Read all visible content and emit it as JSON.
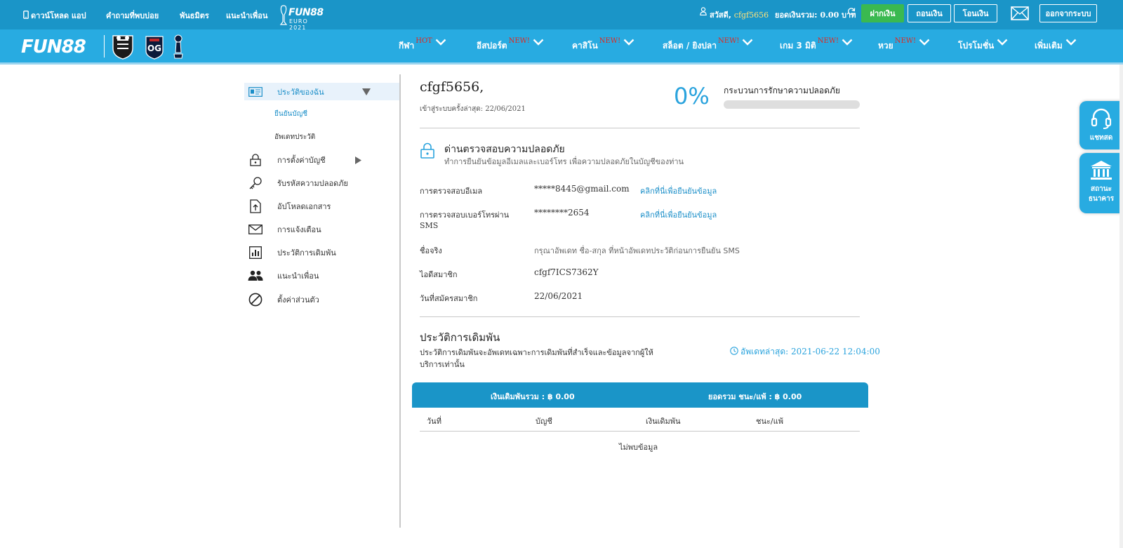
{
  "topbar": {
    "download_app": "ดาวน์โหลด แอป",
    "faq": "คำถามที่พบบ่อย",
    "affiliate": "พันธมิตร",
    "refer_friend": "แนะนำเพื่อน",
    "euro_logo_brand": "FUN88",
    "euro_logo_sub": "EURO 2021",
    "greeting": "สวัสดี,",
    "username": "cfgf5656",
    "balance_label": "ยอดเงินรวม:",
    "balance_value": "0.00 บาท",
    "deposit": "ฝากเงิน",
    "withdraw": "ถอนเงิน",
    "transfer": "โอนเงิน",
    "logout": "ออกจากระบบ"
  },
  "navbar": {
    "brand": "FUN88",
    "items": [
      {
        "label": "กีฬา",
        "badge": "HOT"
      },
      {
        "label": "อีสปอร์ต",
        "badge": "NEW!"
      },
      {
        "label": "คาสิโน",
        "badge": "NEW!"
      },
      {
        "label": "สล็อต / ยิงปลา",
        "badge": "NEW!"
      },
      {
        "label": "เกม 3 มิติ",
        "badge": "NEW!"
      },
      {
        "label": "หวย",
        "badge": "NEW!"
      },
      {
        "label": "โปรโมชั่น",
        "badge": ""
      },
      {
        "label": "เพิ่มเติม",
        "badge": ""
      }
    ]
  },
  "sidebar": {
    "my_profile": "ประวัติของฉัน",
    "verify_account": "ยืนยันบัญชี",
    "update_profile": "อัพเดทประวัติ",
    "account_settings": "การตั้งค่าบัญชี",
    "security_code": "รับรหัสความปลอดภัย",
    "upload_docs": "อัปโหลดเอกสาร",
    "notifications": "การแจ้งเตือน",
    "bet_history": "ประวัติการเดิมพัน",
    "refer_friend": "แนะนำเพื่อน",
    "personal_settings": "ตั้งค่าส่วนตัว"
  },
  "profile": {
    "username_heading": "cfgf5656,",
    "last_login": "เข้าสู่ระบบครั้งล่าสุด: 22/06/2021",
    "progress_percent_label": "0%",
    "progress_percent": 0,
    "progress_title": "กระบวนการรักษาความปลอดภัย"
  },
  "security": {
    "title": "ด่านตรวจสอบความปลอดภัย",
    "subtitle": "ทำการยืนยันข้อมูลอีเมลและเบอร์โทร เพื่อความปลอดภัยในบัญชีของท่าน",
    "rows": [
      {
        "label": "การตรวจสอบอีเมล",
        "value": "*****8445@gmail.com",
        "action": "คลิกที่นี่เพื่อยืนยันข้อมูล"
      },
      {
        "label": "การตรวจสอบเบอร์โทรผ่าน",
        "label2": "SMS",
        "value": "********2654",
        "action": "คลิกที่นี่เพื่อยืนยันข้อมูล"
      },
      {
        "label": "ชื่อจริง",
        "value": "กรุณาอัพเดท ชื่อ-สกุล ที่หน้าอัพเดทประวัติก่อนการยืนยัน SMS",
        "action": ""
      },
      {
        "label": "ไอดีสมาชิก",
        "value": "cfgf7ICS7362Y",
        "action": ""
      },
      {
        "label": "วันที่สมัครสมาชิก",
        "value": "22/06/2021",
        "action": ""
      }
    ]
  },
  "bets": {
    "title": "ประวัติการเดิมพัน",
    "note_line1": "ประวัติการเดิมพันจะอัพเดทเฉพาะการเดิมพันที่สำเร็จและข้อมูลจากผู้ให้",
    "note_line2": "บริการเท่านั้น",
    "last_update": "อัพเดทล่าสุด: 2021-06-22 12:04:00",
    "total_bet": "เงินเดิมพันรวม : ฿ 0.00",
    "total_winloss": "ยอดรวม ชนะ/แพ้ : ฿ 0.00",
    "columns": [
      "วันที่",
      "บัญชี",
      "เงินเดิมพัน",
      "ชนะ/แพ้"
    ],
    "empty": "ไม่พบข้อมูล"
  },
  "floating": {
    "chat": "แชทสด",
    "bank_status_line1": "สถานะ",
    "bank_status_line2": "ธนาคาร"
  },
  "colors": {
    "topbar": "#1a95c8",
    "navbar": "#28abe1",
    "accent": "#1a8ec8",
    "new_badge": "#e0281f",
    "deposit_green": "#3ab950"
  }
}
